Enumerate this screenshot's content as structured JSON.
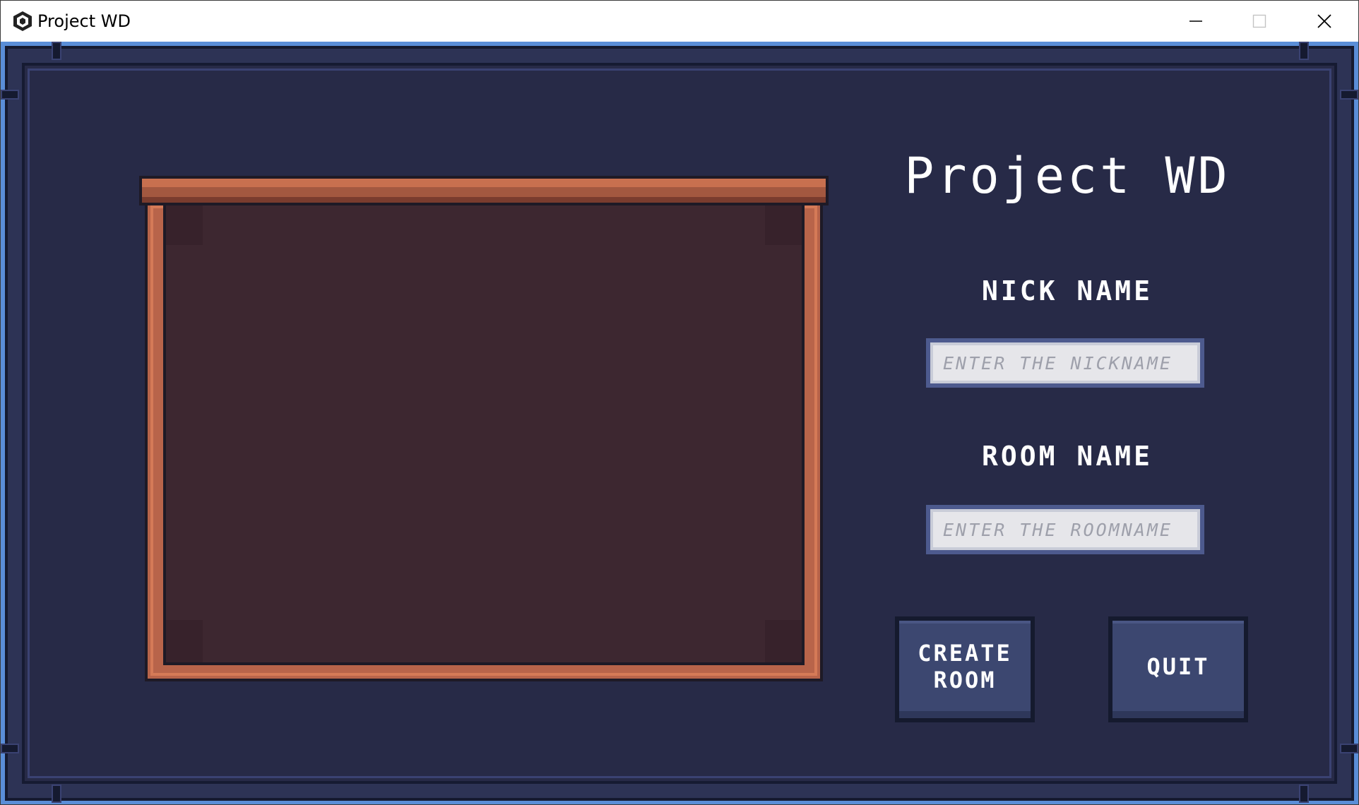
{
  "window": {
    "title": "Project WD",
    "controls": {
      "minimize": "minimize-icon",
      "maximize": "maximize-icon",
      "close": "close-icon"
    }
  },
  "menu": {
    "title": "Project WD",
    "nickname": {
      "label": "NICK NAME",
      "placeholder": "ENTER THE NICKNAME",
      "value": ""
    },
    "roomname": {
      "label": "ROOM NAME",
      "placeholder": "ENTER THE ROOMNAME",
      "value": ""
    },
    "buttons": {
      "create_room": "CREATE\nROOM",
      "quit": "QUIT"
    }
  },
  "colors": {
    "window_border": "#5a8ed8",
    "panel": "#272a47",
    "board_frame": "#b8644a",
    "board_surface": "#3d2730",
    "button": "#3c4770",
    "text": "#ffffff"
  }
}
